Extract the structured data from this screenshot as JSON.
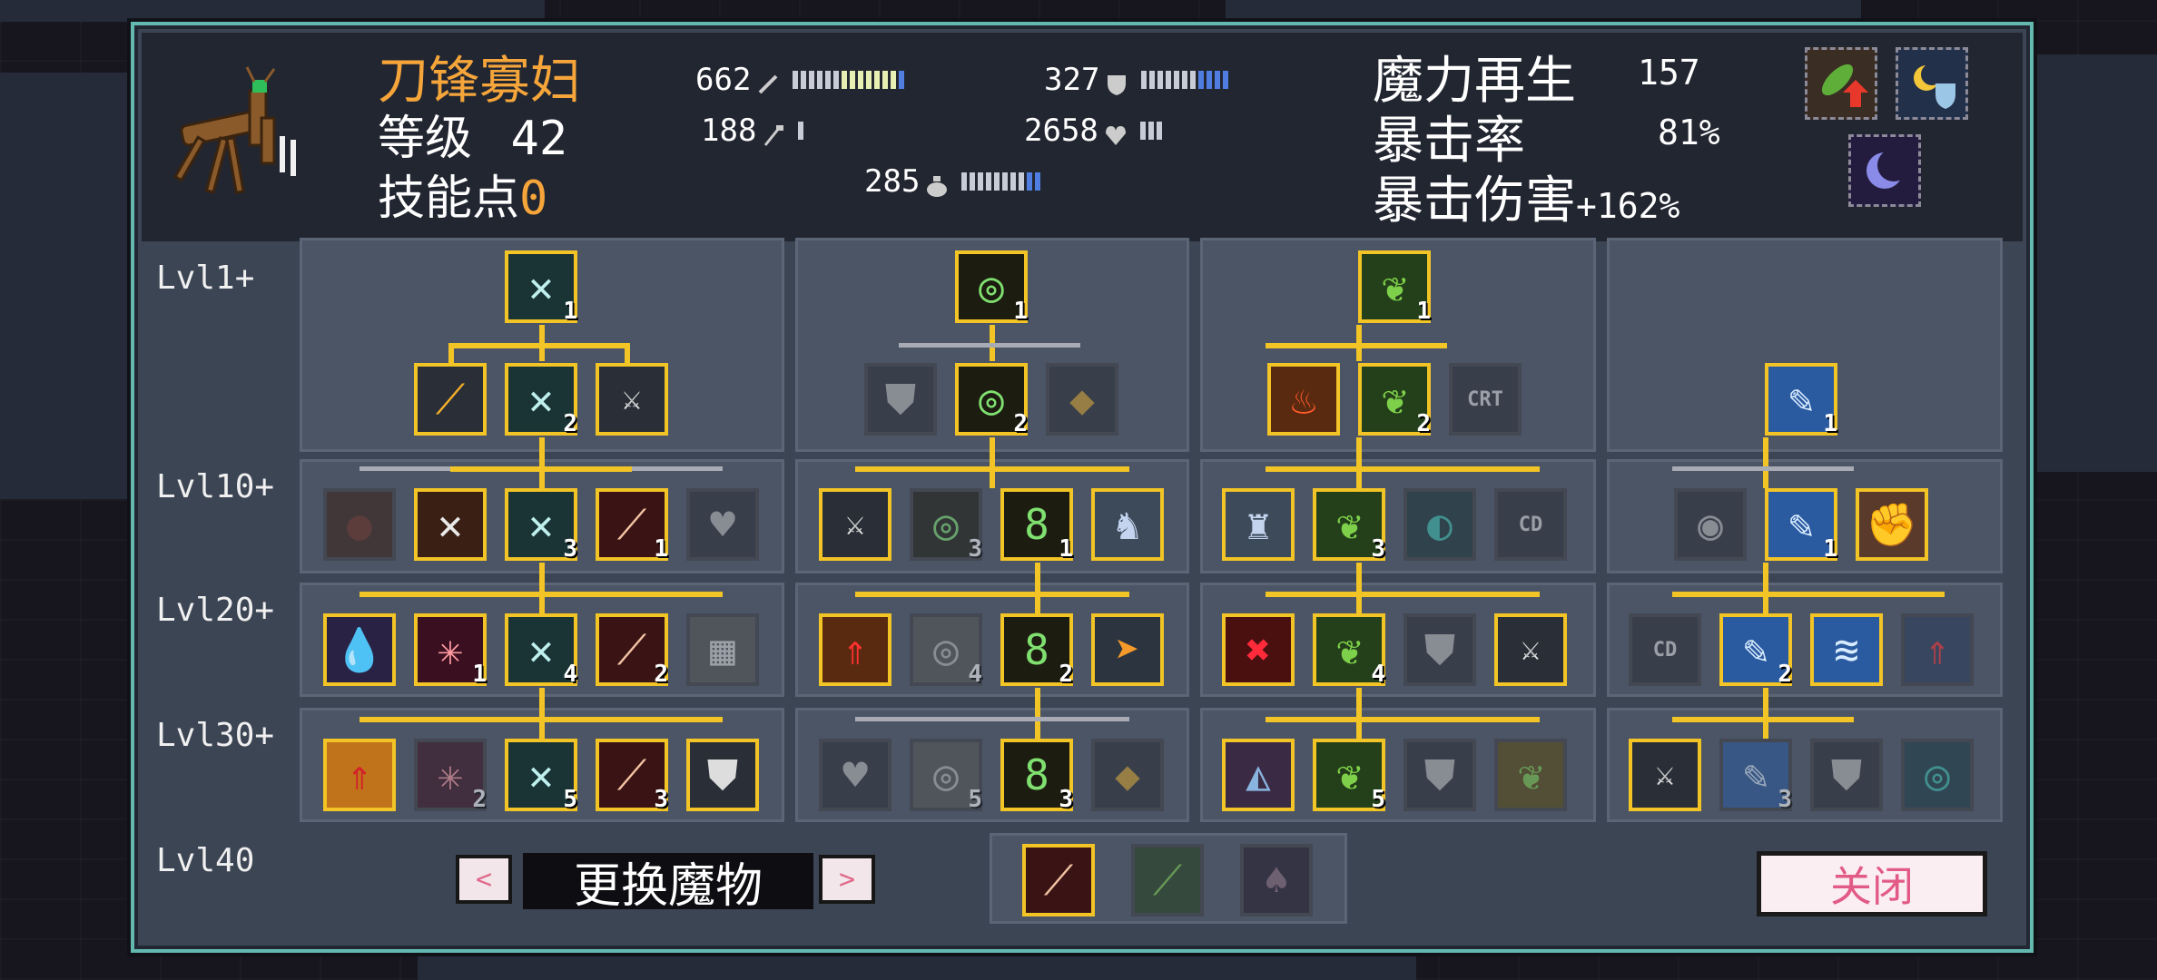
{
  "character": {
    "name": "刀锋寡妇",
    "level_label": "等级",
    "level": "42",
    "skill_points_label": "技能点",
    "skill_points": "0"
  },
  "stats": {
    "attack": "662",
    "defense": "327",
    "speed": "188",
    "health": "2658",
    "mana": "285"
  },
  "right_stats": {
    "mana_regen_label": "魔力再生",
    "mana_regen": "157",
    "crit_rate_label": "暴击率",
    "crit_rate": "81%",
    "crit_damage_label": "暴击伤害",
    "crit_damage": "+162%"
  },
  "status_icons": [
    "leaf-boost-icon",
    "moon-shield-icon",
    "crescent-moon-icon"
  ],
  "tree": {
    "levels": [
      "Lvl1+",
      "Lvl10+",
      "Lvl20+",
      "Lvl30+",
      "Lvl40"
    ],
    "counts": {
      "blade_t1": "1",
      "blade_t2": "2",
      "blade_t3": "3",
      "blade_t3b": "1",
      "blade_t4a": "1",
      "blade_t4": "4",
      "blade_t4b": "2",
      "blade_t5a": "2",
      "blade_t5": "5",
      "blade_t5b": "3",
      "ring_t1": "1",
      "ring_t2": "2",
      "ring_t3a": "3",
      "ring_t3": "1",
      "ring_t4d": "4",
      "ring_t4": "2",
      "ring_t5d": "5",
      "ring_t5": "3",
      "leaf_t1": "1",
      "leaf_t2": "2",
      "leaf_t3": "3",
      "leaf_t4": "4",
      "leaf_t5": "5",
      "wing_t1": "1",
      "wing_t2": "1",
      "wing_t3": "2",
      "wing_t4": "3"
    },
    "crt_label": "CRT",
    "cd_label": "CD"
  },
  "bottom": {
    "change_monster": "更换魔物",
    "prev": "<",
    "next": ">",
    "close": "关闭"
  },
  "colors": {
    "accent_orange": "#f5a53a",
    "node_border": "#f2c426",
    "panel_border": "#63b8b0"
  }
}
